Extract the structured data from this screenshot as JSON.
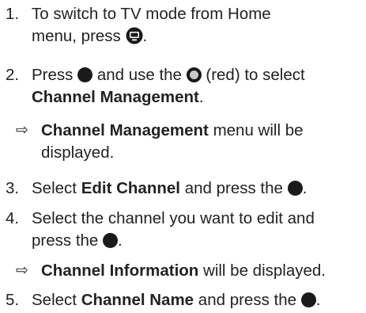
{
  "steps": [
    {
      "num": "1.",
      "line1": "To switch to TV mode from Home",
      "line2_a": "menu, press",
      "line2_b": "."
    },
    {
      "num": "2.",
      "a": "Press",
      "b": "and use the",
      "c": "(red) to select",
      "bold": "Channel Management",
      "d": "."
    },
    {
      "num": "3.",
      "a": "Select",
      "bold": "Edit Channel",
      "b": "and press the",
      "c": "."
    },
    {
      "num": "4.",
      "line1": "Select the channel you want to edit and",
      "line2_a": "press the",
      "line2_b": "."
    },
    {
      "num": "5.",
      "a": "Select",
      "bold": "Channel Name",
      "b": "and press the",
      "c": "."
    }
  ],
  "results": [
    {
      "arrow": "⇨",
      "bold": "Channel Management",
      "a": "menu will be",
      "line2": "displayed."
    },
    {
      "arrow": "⇨",
      "bold": "Channel Information",
      "a": "will be displayed."
    }
  ],
  "icons": {
    "tv_button": "tv-button-icon",
    "ok_button": "ok-button-icon",
    "red_button": "red-button-icon"
  },
  "colors": {
    "text": "#222222",
    "icon": "#1a1a1a"
  }
}
